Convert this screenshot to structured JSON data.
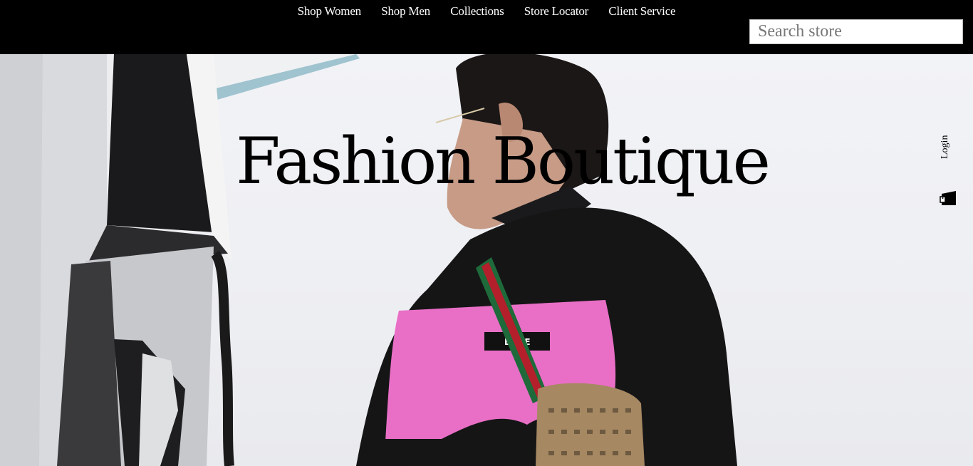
{
  "nav": {
    "items": [
      {
        "label": "Shop Women"
      },
      {
        "label": "Shop Men"
      },
      {
        "label": "Collections"
      },
      {
        "label": "Store Locator"
      },
      {
        "label": "Client Service"
      }
    ]
  },
  "search": {
    "placeholder": "Search store",
    "value": ""
  },
  "hero": {
    "title": "Fashion Boutique",
    "image_alt": "man in black and pink sweatshirt at a fuel pump",
    "shirt_text": "EEME"
  },
  "utility": {
    "login_label": "Login",
    "cart_icon": "shopping-bag-icon"
  },
  "colors": {
    "header_bg": "#000000",
    "nav_text": "#ffffff",
    "title_text": "#000000",
    "accent_pink": "#e96fc6"
  }
}
